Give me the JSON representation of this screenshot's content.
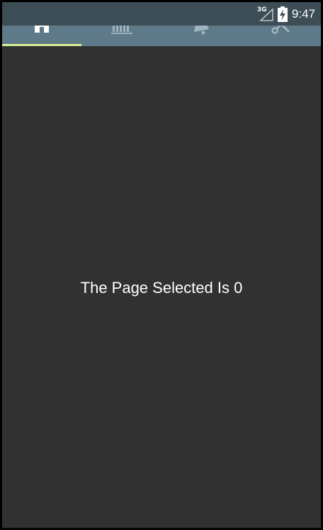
{
  "status_bar": {
    "network_label": "3G",
    "time": "9:47",
    "icons": [
      "signal-icon",
      "battery-charging-icon"
    ]
  },
  "tabs": [
    {
      "icon": "home-icon",
      "selected": true
    },
    {
      "icon": "bar-chart-icon",
      "selected": false
    },
    {
      "icon": "bell-icon",
      "selected": false
    },
    {
      "icon": "tools-icon",
      "selected": false
    }
  ],
  "content": {
    "message": "The Page Selected Is 0"
  },
  "colors": {
    "tab_bar": "#5e7a88",
    "status_bar": "#3d4d55",
    "background": "#313131",
    "indicator": "#d7ef95"
  }
}
